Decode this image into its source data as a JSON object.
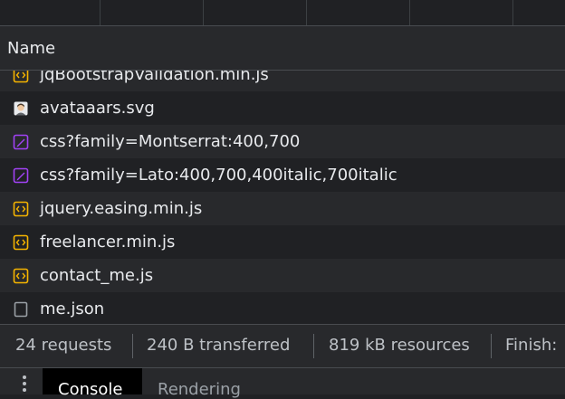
{
  "header": {
    "name_label": "Name"
  },
  "requests": [
    {
      "name": "jqBootstrapValidation.min.js",
      "icon": "script-icon"
    },
    {
      "name": "avataaars.svg",
      "icon": "image-icon"
    },
    {
      "name": "css?family=Montserrat:400,700",
      "icon": "stylesheet-icon"
    },
    {
      "name": "css?family=Lato:400,700,400italic,700italic",
      "icon": "stylesheet-icon"
    },
    {
      "name": "jquery.easing.min.js",
      "icon": "script-icon"
    },
    {
      "name": "freelancer.min.js",
      "icon": "script-icon"
    },
    {
      "name": "contact_me.js",
      "icon": "script-icon"
    },
    {
      "name": "me.json",
      "icon": "document-icon"
    }
  ],
  "summary": {
    "requests": "24 requests",
    "transferred": "240 B transferred",
    "resources": "819 kB resources",
    "finish": "Finish:"
  },
  "drawer": {
    "console_tab": "Console",
    "rendering_tab": "Rendering"
  },
  "colors": {
    "script": "#f5b400",
    "stylesheet": "#a142f4",
    "background": "#202124"
  }
}
